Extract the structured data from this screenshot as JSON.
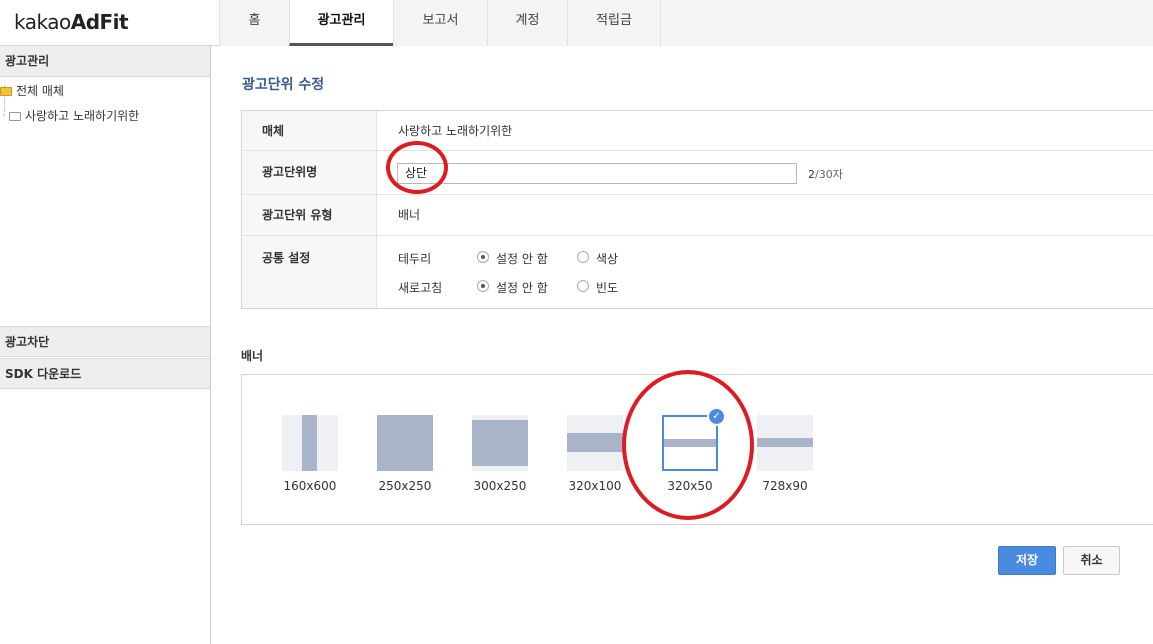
{
  "logo": {
    "prefix": "kakao",
    "brand": "AdFit"
  },
  "nav": {
    "tabs": [
      {
        "label": "홈",
        "active": false
      },
      {
        "label": "광고관리",
        "active": true
      },
      {
        "label": "보고서",
        "active": false
      },
      {
        "label": "계정",
        "active": false
      },
      {
        "label": "적립금",
        "active": false
      }
    ]
  },
  "sidebar": {
    "header": "광고관리",
    "tree": {
      "root": "전체 매체",
      "child": "사랑하고 노래하기위한"
    },
    "sections": [
      "광고차단",
      "SDK 다운로드"
    ]
  },
  "page": {
    "title": "광고단위 수정"
  },
  "form": {
    "media": {
      "label": "매체",
      "value": "사랑하고 노래하기위한"
    },
    "unit_name": {
      "label": "광고단위명",
      "value": "상단",
      "count": "2",
      "max": "/30자"
    },
    "unit_type": {
      "label": "광고단위 유형",
      "value": "배너"
    },
    "common": {
      "label": "공통 설정",
      "border": {
        "label": "테두리",
        "options": [
          "설정 안 함",
          "색상"
        ],
        "selected": "설정 안 함"
      },
      "refresh": {
        "label": "새로고침",
        "options": [
          "설정 안 함",
          "빈도"
        ],
        "selected": "설정 안 함"
      }
    }
  },
  "banner": {
    "title": "배너",
    "sizes": [
      "160x600",
      "250x250",
      "300x250",
      "320x100",
      "320x50",
      "728x90"
    ],
    "selected": "320x50"
  },
  "buttons": {
    "save": "저장",
    "cancel": "취소"
  },
  "colors": {
    "accent": "#4a8be0",
    "annotation": "#dc1c25",
    "title": "#3a5a8c"
  }
}
